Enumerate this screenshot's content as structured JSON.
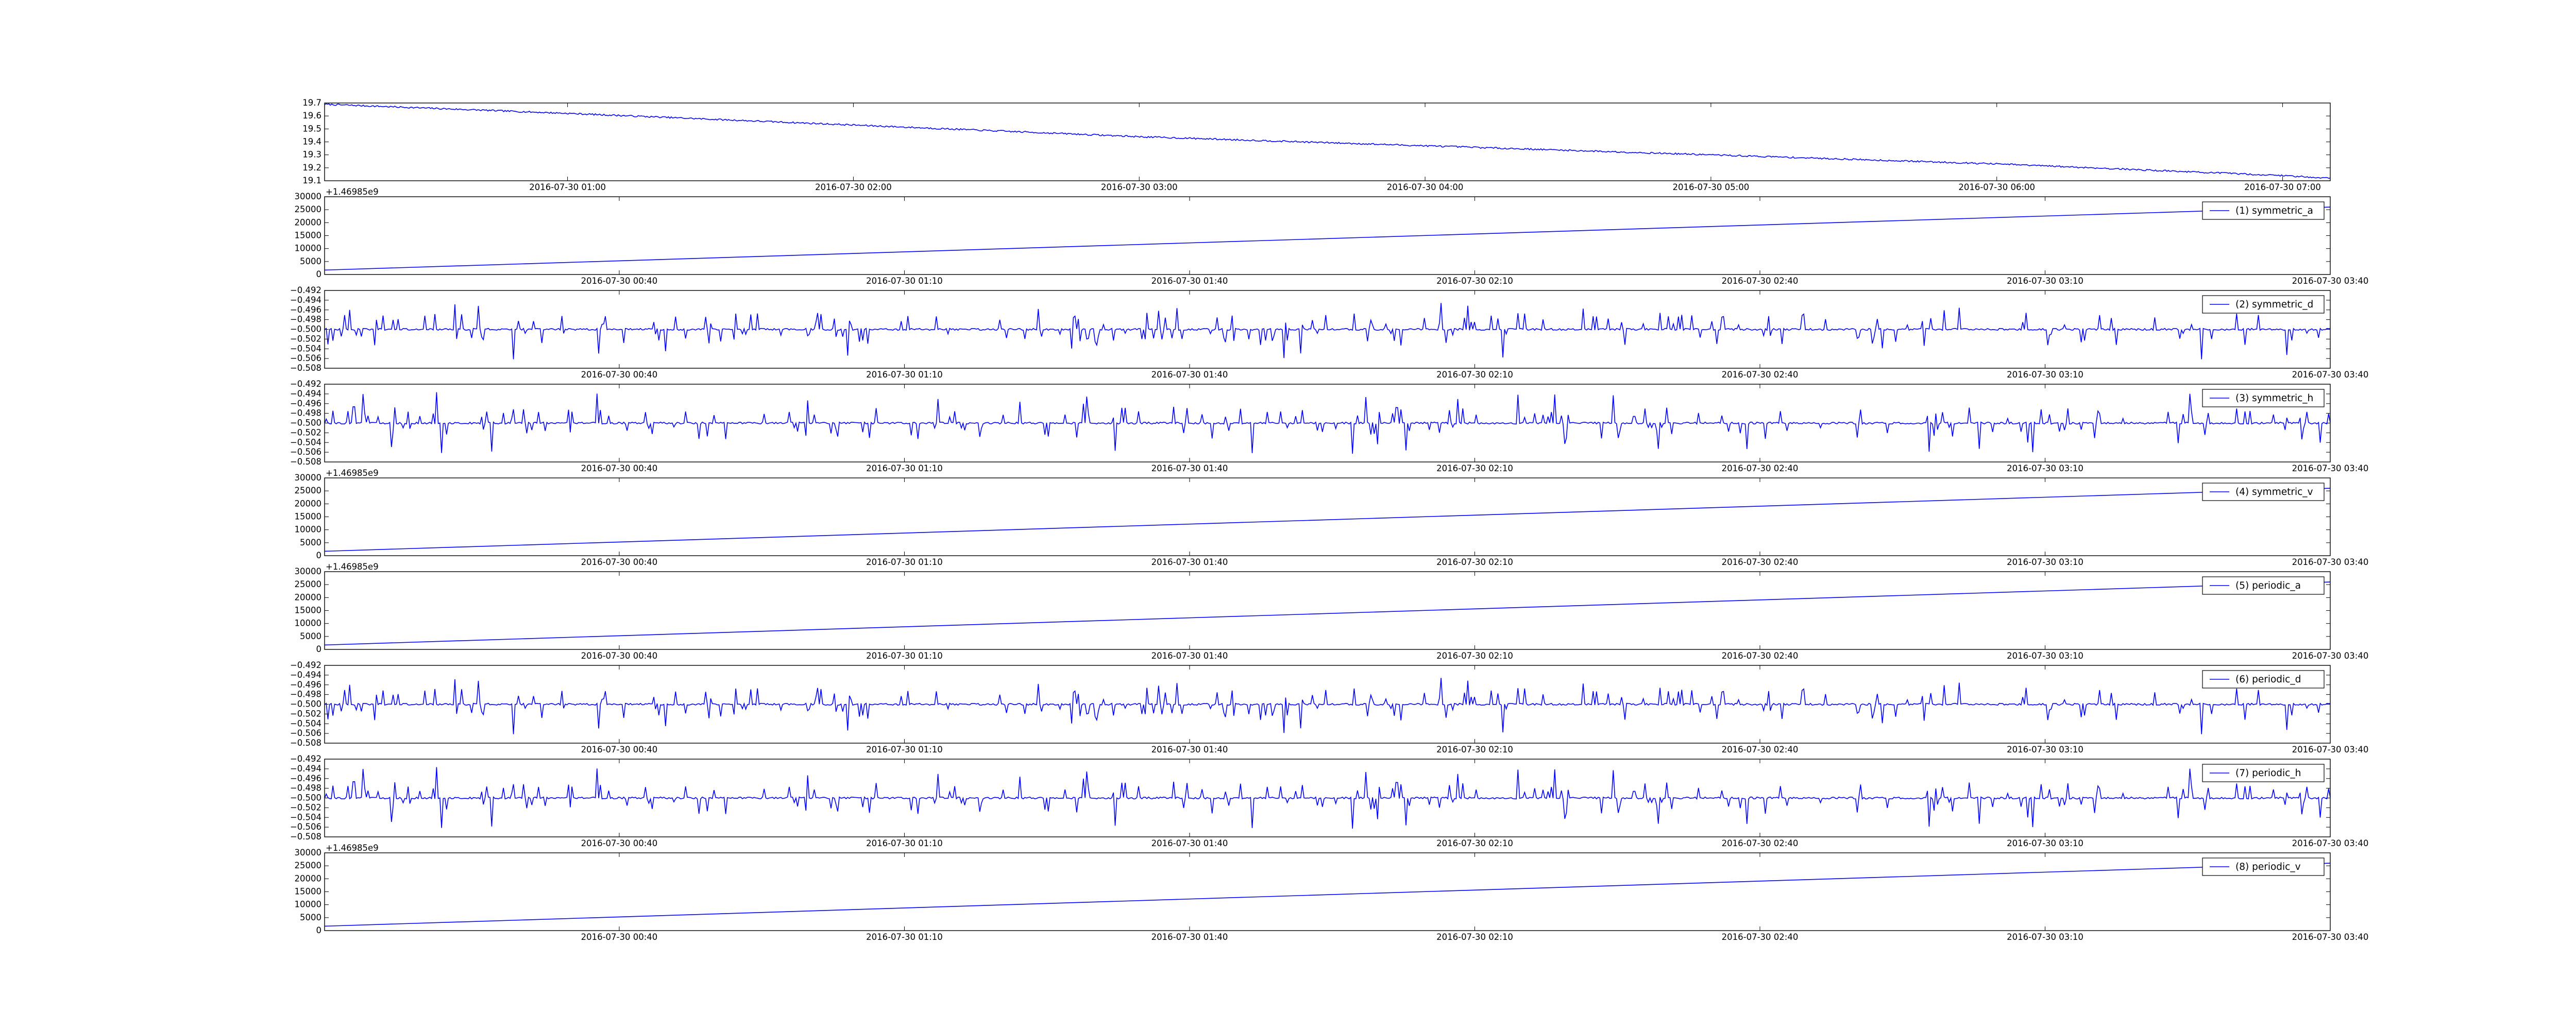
{
  "figure": {
    "background": "#ffffff",
    "series_color": "#0000ff",
    "axes_color": "#000000"
  },
  "chart_data": [
    {
      "type": "line",
      "title": "",
      "xlabel": "",
      "ylabel": "",
      "x_offset_label": "",
      "legend": "",
      "x_ticks": [
        "2016-07-30 01:00",
        "2016-07-30 02:00",
        "2016-07-30 03:00",
        "2016-07-30 04:00",
        "2016-07-30 05:00",
        "2016-07-30 06:00",
        "2016-07-30 07:00"
      ],
      "xlim": [
        "2016-07-30 00:09",
        "2016-07-30 07:10"
      ],
      "y_ticks": [
        "19.1",
        "19.2",
        "19.3",
        "19.4",
        "19.5",
        "19.6",
        "19.7"
      ],
      "ylim": [
        19.1,
        19.7
      ],
      "pattern": "decreasing",
      "x": [
        "2016-07-30 00:09",
        "2016-07-30 01:00",
        "2016-07-30 02:00",
        "2016-07-30 03:00",
        "2016-07-30 04:00",
        "2016-07-30 05:00",
        "2016-07-30 06:00",
        "2016-07-30 07:00",
        "2016-07-30 07:10"
      ],
      "y": [
        19.69,
        19.62,
        19.53,
        19.44,
        19.37,
        19.3,
        19.23,
        19.14,
        19.12
      ]
    },
    {
      "type": "line",
      "x_offset_label": "+1.46985e9",
      "legend": "(1) symmetric_a",
      "x_ticks": [
        "2016-07-30 00:40",
        "2016-07-30 01:10",
        "2016-07-30 01:40",
        "2016-07-30 02:10",
        "2016-07-30 02:40",
        "2016-07-30 03:10",
        "2016-07-30 03:40"
      ],
      "xlim": [
        "2016-07-30 00:09",
        "2016-07-30 03:40"
      ],
      "y_ticks": [
        "0",
        "5000",
        "10000",
        "15000",
        "20000",
        "25000",
        "30000"
      ],
      "ylim": [
        0,
        30000
      ],
      "pattern": "linear",
      "x": [
        "2016-07-30 00:09",
        "2016-07-30 03:40"
      ],
      "y": [
        1700,
        26000
      ]
    },
    {
      "type": "line",
      "x_offset_label": "",
      "legend": "(2) symmetric_d",
      "x_ticks": [
        "2016-07-30 00:40",
        "2016-07-30 01:10",
        "2016-07-30 01:40",
        "2016-07-30 02:10",
        "2016-07-30 02:40",
        "2016-07-30 03:10",
        "2016-07-30 03:40"
      ],
      "xlim": [
        "2016-07-30 00:09",
        "2016-07-30 03:40"
      ],
      "y_ticks": [
        "−0.492",
        "−0.494",
        "−0.496",
        "−0.498",
        "−0.500",
        "−0.502",
        "−0.504",
        "−0.506",
        "−0.508"
      ],
      "ylim": [
        -0.508,
        -0.492
      ],
      "pattern": "noise",
      "baseline": -0.5,
      "seed": 101
    },
    {
      "type": "line",
      "x_offset_label": "",
      "legend": "(3) symmetric_h",
      "x_ticks": [
        "2016-07-30 00:40",
        "2016-07-30 01:10",
        "2016-07-30 01:40",
        "2016-07-30 02:10",
        "2016-07-30 02:40",
        "2016-07-30 03:10",
        "2016-07-30 03:40"
      ],
      "xlim": [
        "2016-07-30 00:09",
        "2016-07-30 03:40"
      ],
      "y_ticks": [
        "−0.492",
        "−0.494",
        "−0.496",
        "−0.498",
        "−0.500",
        "−0.502",
        "−0.504",
        "−0.506",
        "−0.508"
      ],
      "ylim": [
        -0.508,
        -0.492
      ],
      "pattern": "noise",
      "baseline": -0.5,
      "seed": 202
    },
    {
      "type": "line",
      "x_offset_label": "+1.46985e9",
      "legend": "(4) symmetric_v",
      "x_ticks": [
        "2016-07-30 00:40",
        "2016-07-30 01:10",
        "2016-07-30 01:40",
        "2016-07-30 02:10",
        "2016-07-30 02:40",
        "2016-07-30 03:10",
        "2016-07-30 03:40"
      ],
      "xlim": [
        "2016-07-30 00:09",
        "2016-07-30 03:40"
      ],
      "y_ticks": [
        "0",
        "5000",
        "10000",
        "15000",
        "20000",
        "25000",
        "30000"
      ],
      "ylim": [
        0,
        30000
      ],
      "pattern": "linear",
      "x": [
        "2016-07-30 00:09",
        "2016-07-30 03:40"
      ],
      "y": [
        1700,
        26000
      ]
    },
    {
      "type": "line",
      "x_offset_label": "+1.46985e9",
      "legend": "(5) periodic_a",
      "x_ticks": [
        "2016-07-30 00:40",
        "2016-07-30 01:10",
        "2016-07-30 01:40",
        "2016-07-30 02:10",
        "2016-07-30 02:40",
        "2016-07-30 03:10",
        "2016-07-30 03:40"
      ],
      "xlim": [
        "2016-07-30 00:09",
        "2016-07-30 03:40"
      ],
      "y_ticks": [
        "0",
        "5000",
        "10000",
        "15000",
        "20000",
        "25000",
        "30000"
      ],
      "ylim": [
        0,
        30000
      ],
      "pattern": "linear",
      "x": [
        "2016-07-30 00:09",
        "2016-07-30 03:40"
      ],
      "y": [
        1700,
        26000
      ]
    },
    {
      "type": "line",
      "x_offset_label": "",
      "legend": "(6) periodic_d",
      "x_ticks": [
        "2016-07-30 00:40",
        "2016-07-30 01:10",
        "2016-07-30 01:40",
        "2016-07-30 02:10",
        "2016-07-30 02:40",
        "2016-07-30 03:10",
        "2016-07-30 03:40"
      ],
      "xlim": [
        "2016-07-30 00:09",
        "2016-07-30 03:40"
      ],
      "y_ticks": [
        "−0.492",
        "−0.494",
        "−0.496",
        "−0.498",
        "−0.500",
        "−0.502",
        "−0.504",
        "−0.506",
        "−0.508"
      ],
      "ylim": [
        -0.508,
        -0.492
      ],
      "pattern": "noise",
      "baseline": -0.5,
      "seed": 101
    },
    {
      "type": "line",
      "x_offset_label": "",
      "legend": "(7) periodic_h",
      "x_ticks": [
        "2016-07-30 00:40",
        "2016-07-30 01:10",
        "2016-07-30 01:40",
        "2016-07-30 02:10",
        "2016-07-30 02:40",
        "2016-07-30 03:10",
        "2016-07-30 03:40"
      ],
      "xlim": [
        "2016-07-30 00:09",
        "2016-07-30 03:40"
      ],
      "y_ticks": [
        "−0.492",
        "−0.494",
        "−0.496",
        "−0.498",
        "−0.500",
        "−0.502",
        "−0.504",
        "−0.506",
        "−0.508"
      ],
      "ylim": [
        -0.508,
        -0.492
      ],
      "pattern": "noise",
      "baseline": -0.5,
      "seed": 202
    },
    {
      "type": "line",
      "x_offset_label": "+1.46985e9",
      "legend": "(8) periodic_v",
      "x_ticks": [
        "2016-07-30 00:40",
        "2016-07-30 01:10",
        "2016-07-30 01:40",
        "2016-07-30 02:10",
        "2016-07-30 02:40",
        "2016-07-30 03:10",
        "2016-07-30 03:40"
      ],
      "xlim": [
        "2016-07-30 00:09",
        "2016-07-30 03:40"
      ],
      "y_ticks": [
        "0",
        "5000",
        "10000",
        "15000",
        "20000",
        "25000",
        "30000"
      ],
      "ylim": [
        0,
        30000
      ],
      "pattern": "linear",
      "x": [
        "2016-07-30 00:09",
        "2016-07-30 03:40"
      ],
      "y": [
        1700,
        26000
      ]
    }
  ]
}
